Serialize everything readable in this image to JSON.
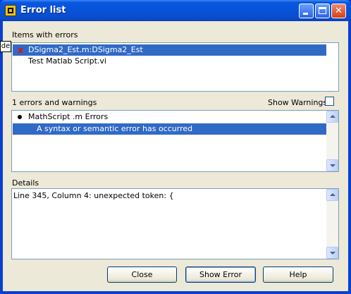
{
  "window": {
    "title": "Error list"
  },
  "items_section": {
    "label": "Items with errors",
    "rows": [
      {
        "text": "DSigma2_Est.m:DSigma2_Est",
        "selected": true,
        "icon": "error-x-icon"
      },
      {
        "text": "Test Matlab Script.vi",
        "selected": false,
        "icon": ""
      }
    ]
  },
  "tooltip_fragment": "de",
  "errors_section": {
    "count_label": "1 errors and warnings",
    "show_warnings_label": "Show Warnings",
    "show_warnings_checked": false,
    "rows": [
      {
        "text": "MathScript .m Errors",
        "selected": false,
        "icon": "bullet-icon"
      },
      {
        "text": "A syntax or semantic error has occurred",
        "selected": true,
        "icon": ""
      }
    ]
  },
  "details_section": {
    "label": "Details",
    "text": "Line 345, Column 4: unexpected token: {"
  },
  "buttons": {
    "close": "Close",
    "show_error": "Show Error",
    "help": "Help"
  },
  "colors": {
    "selection": "#316ac5",
    "titlebar": "#0856e0",
    "face": "#ece9d8"
  }
}
